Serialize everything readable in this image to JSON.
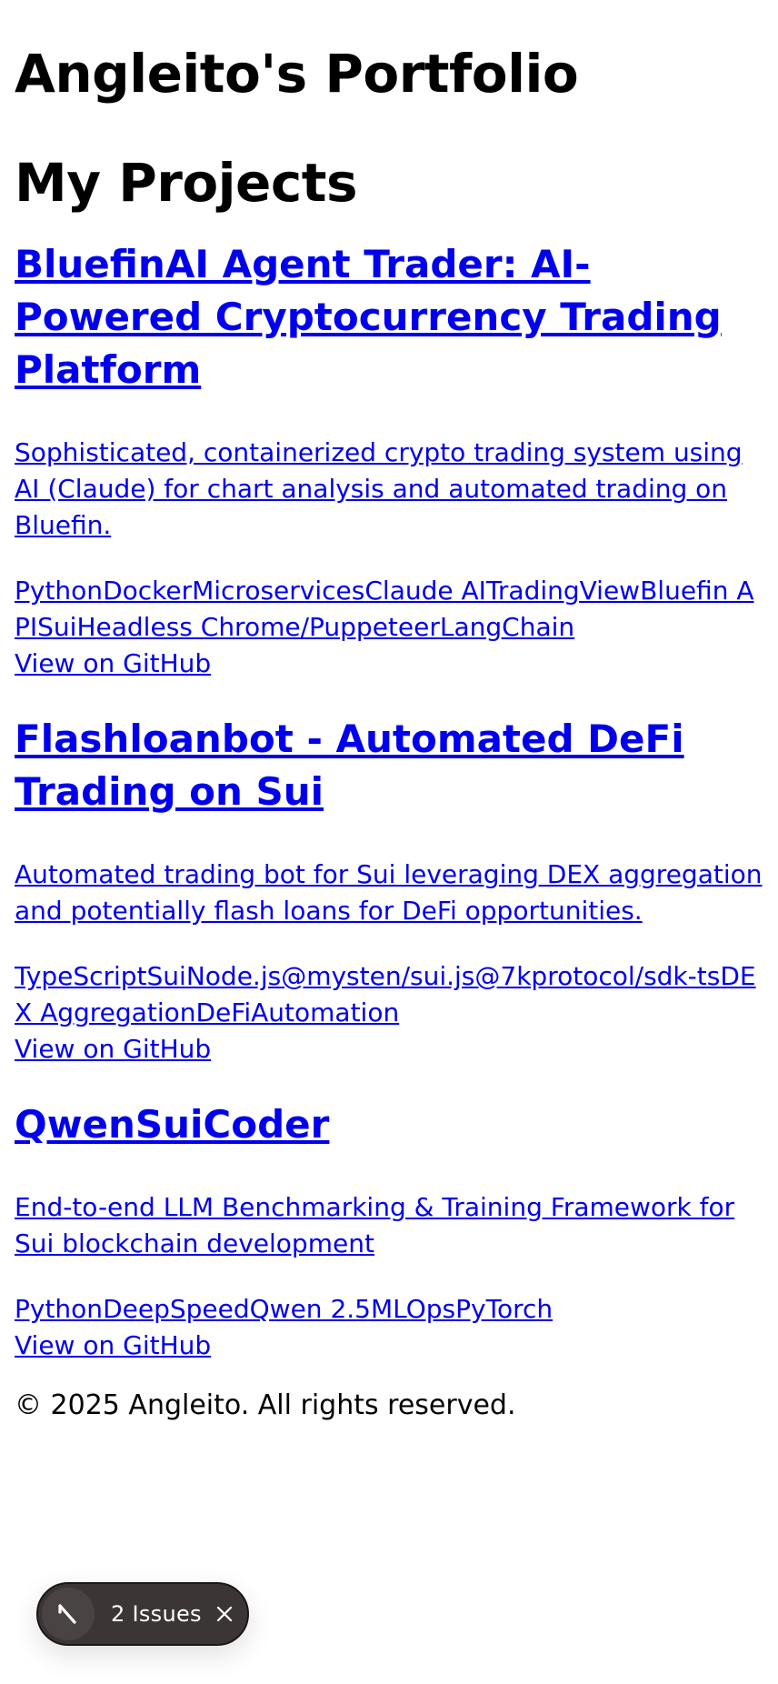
{
  "header": {
    "title": "Angleito's Portfolio"
  },
  "projects_section": {
    "heading": "My Projects",
    "projects": [
      {
        "title": "BluefinAI Agent Trader: AI-Powered Cryptocurrency Trading Platform",
        "description": "Sophisticated, containerized crypto trading system using AI (Claude) for chart analysis and automated trading on Bluefin.",
        "tech": [
          "Python",
          "Docker",
          "Microservices",
          "Claude AI",
          "TradingView",
          "Bluefin API",
          "Sui",
          "Headless Chrome/Puppeteer",
          "LangChain"
        ],
        "link_label": "View on GitHub"
      },
      {
        "title": "Flashloanbot - Automated DeFi Trading on Sui",
        "description": "Automated trading bot for Sui leveraging DEX aggregation and potentially flash loans for DeFi opportunities.",
        "tech": [
          "TypeScript",
          "Sui",
          "Node.js",
          "@mysten/sui.js",
          "@7kprotocol/sdk-ts",
          "DEX Aggregation",
          "DeFi",
          "Automation"
        ],
        "link_label": "View on GitHub"
      },
      {
        "title": "QwenSuiCoder",
        "description": "End-to-end LLM Benchmarking & Training Framework for Sui blockchain development",
        "tech": [
          "Python",
          "DeepSpeed",
          "Qwen 2.5",
          "MLOps",
          "PyTorch"
        ],
        "link_label": "View on GitHub"
      }
    ]
  },
  "footer": {
    "copyright": "© 2025 Angleito. All rights reserved."
  },
  "issues_badge": {
    "label": "2 Issues",
    "logo_icon": "nextjs-logo-icon",
    "close_icon": "close-icon"
  }
}
